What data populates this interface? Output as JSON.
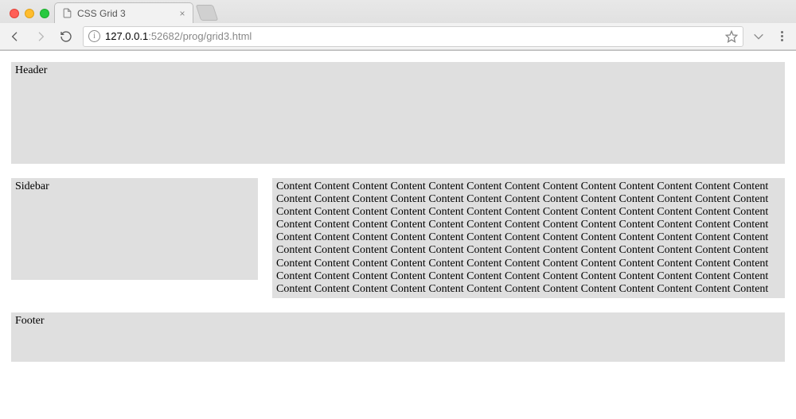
{
  "browser": {
    "tab_title": "CSS Grid 3",
    "url_host": "127.0.0.1",
    "url_port_path": ":52682/prog/grid3.html"
  },
  "page": {
    "header_label": "Header",
    "sidebar_label": "Sidebar",
    "footer_label": "Footer",
    "content_word": "Content",
    "content_repeat": 117
  }
}
